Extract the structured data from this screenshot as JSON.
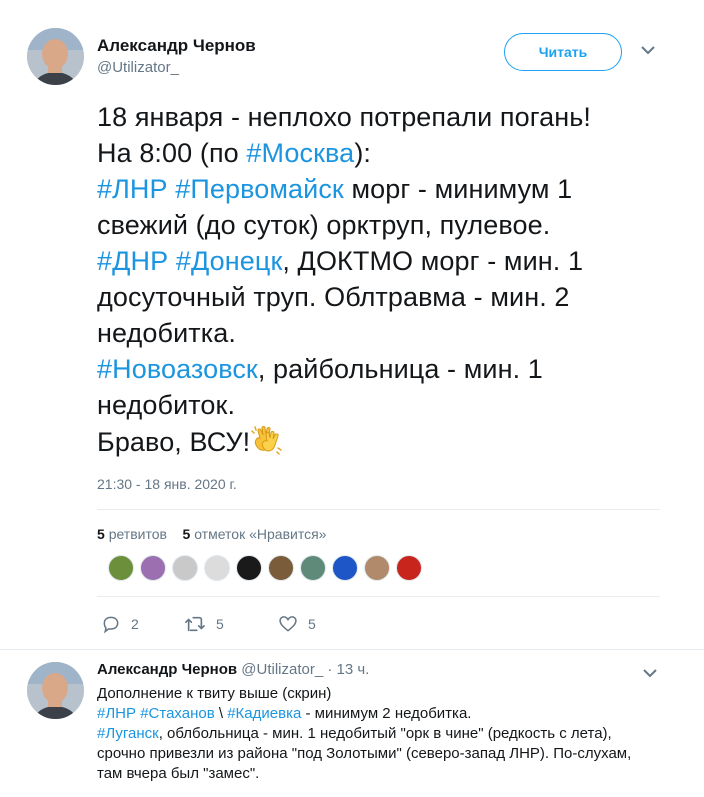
{
  "main_tweet": {
    "author_name": "Александр Чернов",
    "author_handle": "@Utilizator_",
    "follow_label": "Читать",
    "lines": [
      [
        {
          "t": "18 января - неплохо потрепали погань!"
        }
      ],
      [
        {
          "t": "На 8:00 (по "
        },
        {
          "t": "#Москва",
          "tag": true
        },
        {
          "t": "):"
        }
      ],
      [
        {
          "t": "#ЛНР",
          "tag": true
        },
        {
          "t": " "
        },
        {
          "t": "#Первомайск",
          "tag": true
        },
        {
          "t": " морг - минимум 1"
        }
      ],
      [
        {
          "t": "свежий (до суток) орктруп, пулевое."
        }
      ],
      [
        {
          "t": "#ДНР",
          "tag": true
        },
        {
          "t": " "
        },
        {
          "t": "#Донецк",
          "tag": true
        },
        {
          "t": ", ДОКТМО морг - мин. 1"
        }
      ],
      [
        {
          "t": "досуточный труп. Облтравма - мин. 2"
        }
      ],
      [
        {
          "t": "недобитка."
        }
      ],
      [
        {
          "t": "#Новоазовск",
          "tag": true
        },
        {
          "t": ", райбольница - мин. 1"
        }
      ],
      [
        {
          "t": "недобиток."
        }
      ],
      [
        {
          "t": "Браво, ВСУ!"
        },
        {
          "emoji": "clapping-hands"
        }
      ]
    ],
    "timestamp": "21:30 - 18 янв. 2020 г.",
    "retweets_count": "5",
    "retweets_label": "ретвитов",
    "likes_count": "5",
    "likes_label": "отметок «Нравится»",
    "actions": {
      "reply_count": "2",
      "retweet_count": "5",
      "like_count": "5"
    }
  },
  "likers": [
    {
      "color": "#6b8f3a",
      "icon": "landscape-avatar"
    },
    {
      "color": "#9b6fb0",
      "icon": "portrait-avatar"
    },
    {
      "color": "#c9c9c9",
      "icon": "emblem-avatar"
    },
    {
      "color": "#dcdcdc",
      "icon": "portrait-avatar"
    },
    {
      "color": "#1a1a1a",
      "icon": "star-avatar"
    },
    {
      "color": "#7a5b3a",
      "icon": "portrait-avatar"
    },
    {
      "color": "#5f8a7a",
      "icon": "bird-avatar"
    },
    {
      "color": "#1e56c8",
      "icon": "trident-avatar"
    },
    {
      "color": "#b08a6a",
      "icon": "portrait-avatar"
    },
    {
      "color": "#c8251d",
      "icon": "emblem-avatar"
    }
  ],
  "reply_tweet": {
    "author_name": "Александр Чернов",
    "author_handle": "@Utilizator_",
    "time": "· 13 ч.",
    "lines": [
      [
        {
          "t": "Дополнение к твиту выше (скрин)"
        }
      ],
      [
        {
          "t": "#ЛНР",
          "tag": true
        },
        {
          "t": " "
        },
        {
          "t": "#Стаханов",
          "tag": true
        },
        {
          "t": " \\ "
        },
        {
          "t": "#Кадиевка",
          "tag": true
        },
        {
          "t": " - минимум 2 недобитка."
        }
      ],
      [
        {
          "t": "#Луганск",
          "tag": true
        },
        {
          "t": ", облбольница - мин. 1 недобитый \"орк в чине\" (редкость с лета),"
        }
      ],
      [
        {
          "t": "срочно привезли из района \"под Золотыми\" (северо-запад ЛНР). По-слухам,"
        }
      ],
      [
        {
          "t": "там вчера был \"замес\"."
        }
      ]
    ]
  },
  "colors": {
    "link": "#1b95e0",
    "muted": "#657786",
    "text": "#14171a",
    "divider": "#e6ecf0"
  }
}
